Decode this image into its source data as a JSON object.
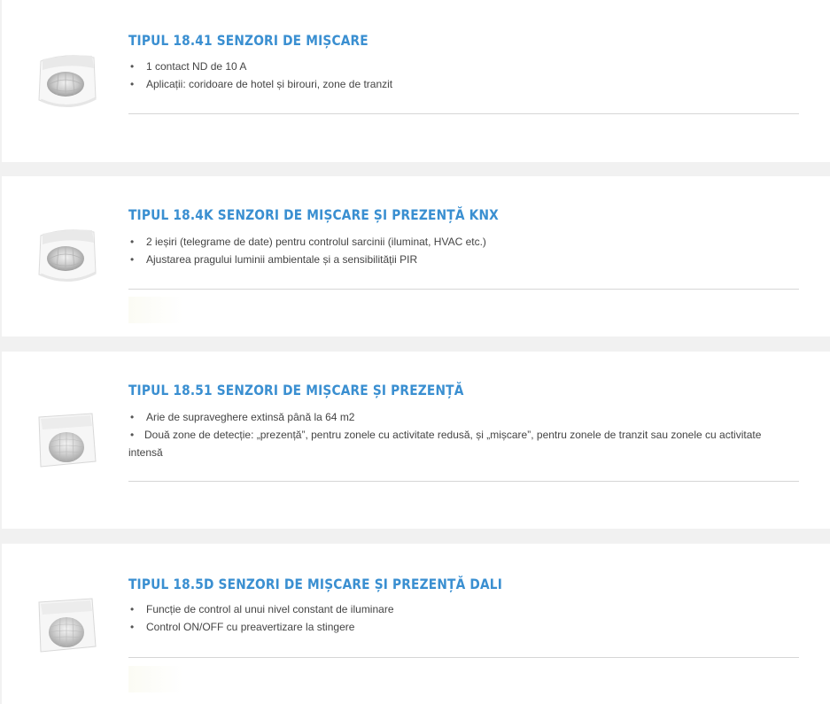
{
  "products": [
    {
      "title": "TIPUL 18.41 SENZORI DE MIȘCARE",
      "thumb_icon": "wall-motion-sensor-icon",
      "bullets": [
        "1 contact ND de 10 A",
        "Aplicații: coridoare de hotel și birouri, zone de tranzit"
      ]
    },
    {
      "title": "TIPUL 18.4K SENZORI DE MIȘCARE ȘI PREZENȚĂ KNX",
      "thumb_icon": "wall-motion-sensor-icon",
      "bullets": [
        "2 ieșiri (telegrame de date) pentru controlul sarcinii (iluminat, HVAC etc.)",
        "Ajustarea pragului luminii ambientale și a sensibilității PIR"
      ]
    },
    {
      "title": "TIPUL 18.51 SENZORI DE MIȘCARE ȘI PREZENȚĂ",
      "thumb_icon": "ceiling-presence-sensor-icon",
      "bullets": [
        "Arie de supraveghere extinsă până la 64 m2",
        "Două zone de detecție: „prezență”, pentru zonele cu activitate redusă, și „mișcare”, pentru zonele de tranzit sau zonele cu activitate intensă"
      ]
    },
    {
      "title": "TIPUL 18.5D SENZORI DE MIȘCARE ȘI PREZENȚĂ DALI",
      "thumb_icon": "ceiling-presence-sensor-icon",
      "bullets": [
        "Funcție de control al unui nivel constant de iluminare",
        "Control ON/OFF cu preavertizare la stingere"
      ]
    }
  ],
  "colors": {
    "title": "#3a8fd1",
    "text": "#444444",
    "card": "#ffffff",
    "page": "#f1f1f1",
    "rule": "#d6d6d6"
  }
}
